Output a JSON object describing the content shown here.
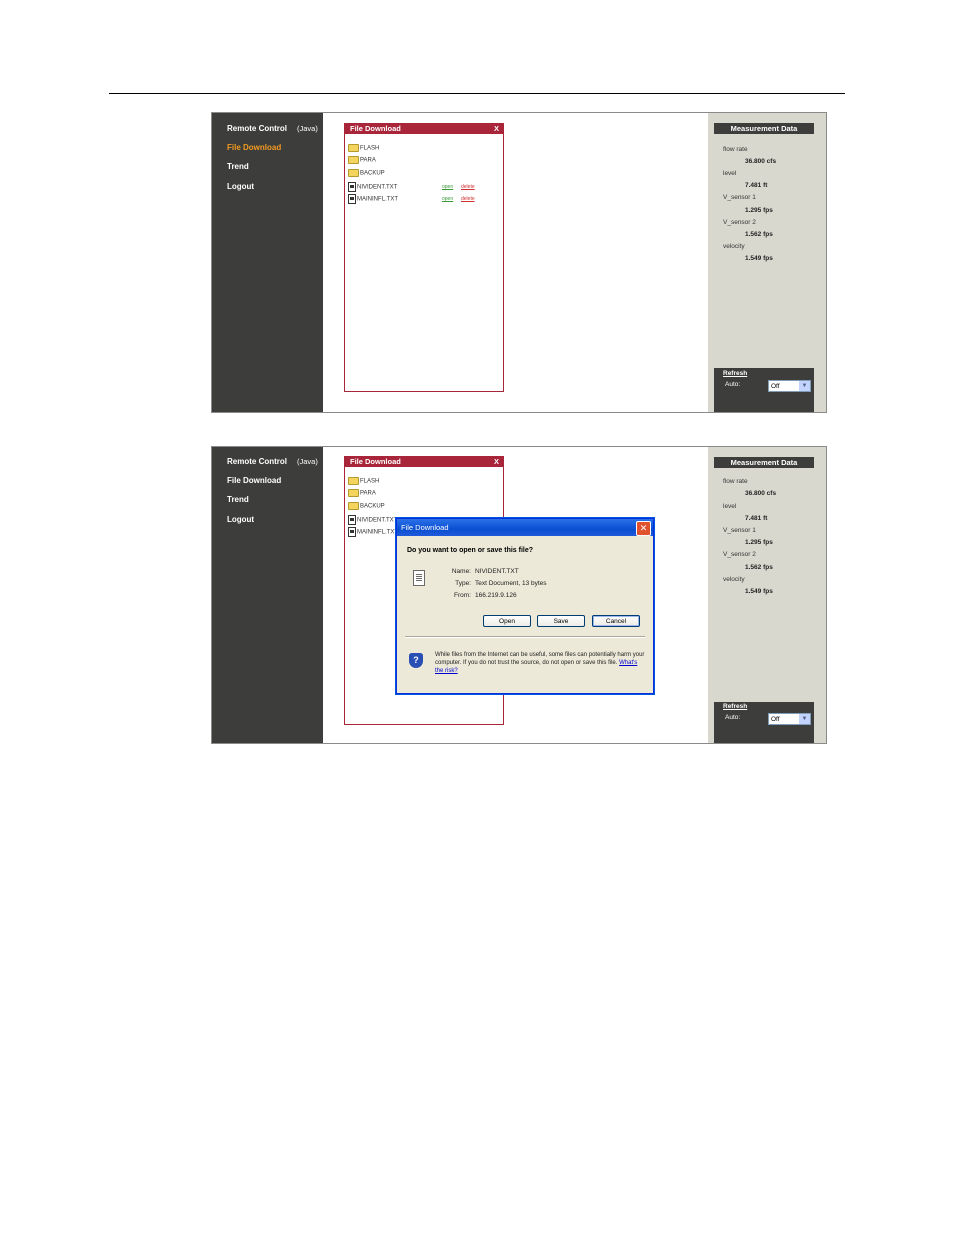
{
  "screens": [
    {
      "nav": {
        "remote_control": "Remote Control",
        "java": "(Java)",
        "file_download": "File Download",
        "trend": "Trend",
        "logout": "Logout"
      },
      "file_panel": {
        "title": "File Download",
        "close": "X",
        "folders": [
          "FLASH",
          "PARA",
          "BACKUP"
        ],
        "files": [
          {
            "name": "NIVIDENT.TXT",
            "open": "open",
            "delete": "delete"
          },
          {
            "name": "MAININFL.TXT",
            "open": "open",
            "delete": "delete"
          }
        ]
      },
      "measurement": {
        "title": "Measurement Data",
        "items": [
          {
            "label": "flow rate",
            "value": "36.800 cfs"
          },
          {
            "label": "level",
            "value": "7.481 ft"
          },
          {
            "label": "V_sensor 1",
            "value": "1.295 fps"
          },
          {
            "label": "V_sensor 2",
            "value": "1.562 fps"
          },
          {
            "label": "velocity",
            "value": "1.549 fps"
          }
        ],
        "refresh": "Refresh",
        "auto_label": "Auto:",
        "auto_value": "Off"
      }
    },
    {
      "nav": {
        "remote_control": "Remote Control",
        "java": "(Java)",
        "file_download": "File Download",
        "trend": "Trend",
        "logout": "Logout"
      },
      "file_panel": {
        "title": "File Download",
        "close": "X",
        "folders": [
          "FLASH",
          "PARA",
          "BACKUP"
        ],
        "files": [
          {
            "name": "NIVIDENT.TXT"
          },
          {
            "name": "MAININFL.TXT"
          }
        ]
      },
      "measurement": {
        "title": "Measurement Data",
        "items": [
          {
            "label": "flow rate",
            "value": "36.800 cfs"
          },
          {
            "label": "level",
            "value": "7.481 ft"
          },
          {
            "label": "V_sensor 1",
            "value": "1.295 fps"
          },
          {
            "label": "V_sensor 2",
            "value": "1.562 fps"
          },
          {
            "label": "velocity",
            "value": "1.549 fps"
          }
        ],
        "refresh": "Refresh",
        "auto_label": "Auto:",
        "auto_value": "Off"
      },
      "dialog": {
        "title": "File Download",
        "question": "Do you want to open or save this file?",
        "name_label": "Name:",
        "name_value": "NIVIDENT.TXT",
        "type_label": "Type:",
        "type_value": "Text Document, 13 bytes",
        "from_label": "From:",
        "from_value": "166.219.9.126",
        "open_btn": "Open",
        "save_btn": "Save",
        "cancel_btn": "Cancel",
        "warning": "While files from the Internet can be useful, some files can potentially harm your computer. If you do not trust the source, do not open or save this file.",
        "risk_link": "What's the risk?"
      }
    }
  ],
  "colors": {
    "sidebar": "#3d3d3b",
    "active_nav": "#f39a1e",
    "panel_header": "#a8253a",
    "measurement_bg": "#d9d8cf",
    "dialog_title": "#0a4fd2"
  }
}
